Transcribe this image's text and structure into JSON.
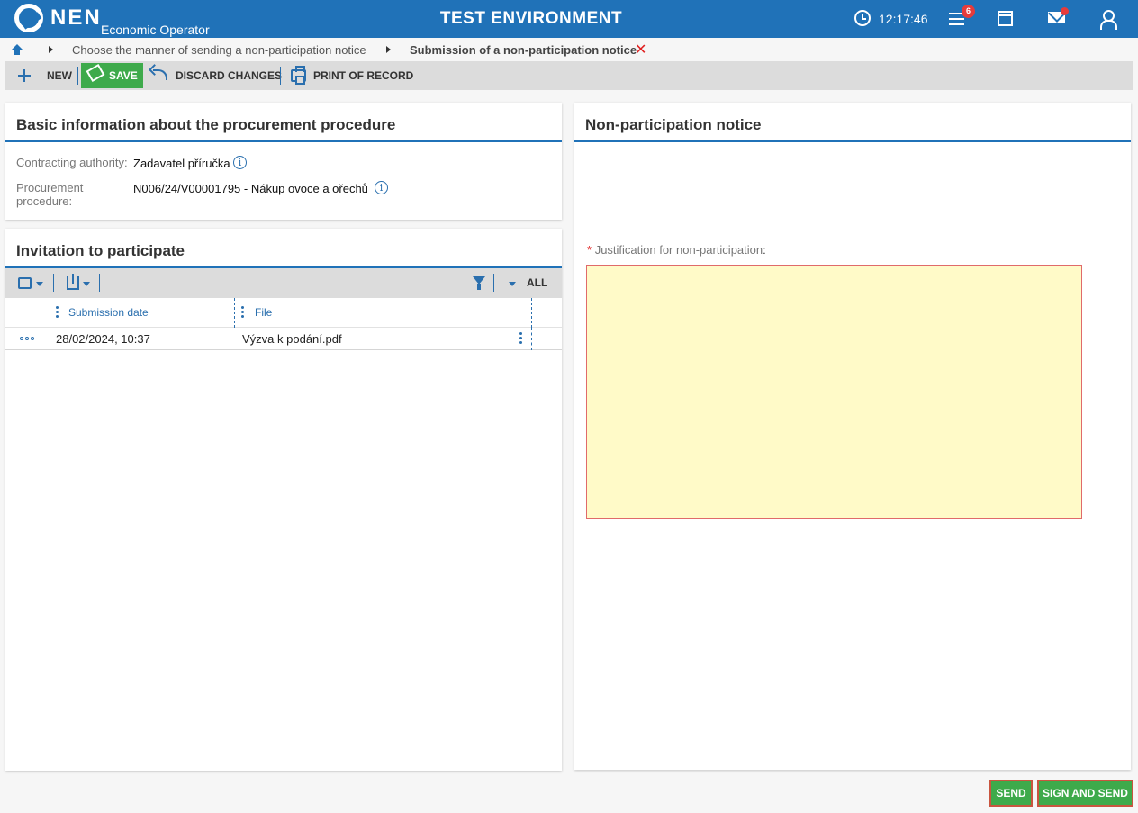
{
  "header": {
    "logo_text": "NEN",
    "logo_subtitle": "Economic Operator",
    "environment": "TEST ENVIRONMENT",
    "clock": "12:17:46",
    "notification_count": "6"
  },
  "breadcrumb": {
    "items": [
      "Choose the manner of sending a non-participation notice",
      "Submission of a non-participation notice"
    ],
    "close_glyph": "✕"
  },
  "toolbar": {
    "new_label": "NEW",
    "save_label": "SAVE",
    "discard_label": "DISCARD CHANGES",
    "print_label": "PRINT OF RECORD"
  },
  "basic_info": {
    "title": "Basic information about the procurement procedure",
    "authority_label": "Contracting authority:",
    "authority_value": "Zadavatel příručka",
    "procedure_label_line1": "Procurement",
    "procedure_label_line2": "procedure:",
    "procedure_value": "N006/24/V00001795 - Nákup ovoce a ořechů",
    "info_glyph": "i"
  },
  "invitation": {
    "title": "Invitation to participate",
    "filter_label": "ALL",
    "columns": [
      "Submission date",
      "File"
    ],
    "rows": [
      {
        "date": "28/02/2024, 10:37",
        "file": "Výzva k podání.pdf"
      }
    ]
  },
  "notice": {
    "title": "Non-participation notice",
    "required_star": "*",
    "justification_label": "Justification for non-participation",
    "label_colon": ":",
    "justification_value": ""
  },
  "footer": {
    "send_label": "SEND",
    "sign_send_label": "SIGN AND SEND"
  },
  "colors": {
    "brand_blue": "#2072b8",
    "accent_blue": "#2a6fae",
    "save_green": "#3eaa4b",
    "required_red": "#e02020",
    "input_bg": "#fffac8"
  }
}
